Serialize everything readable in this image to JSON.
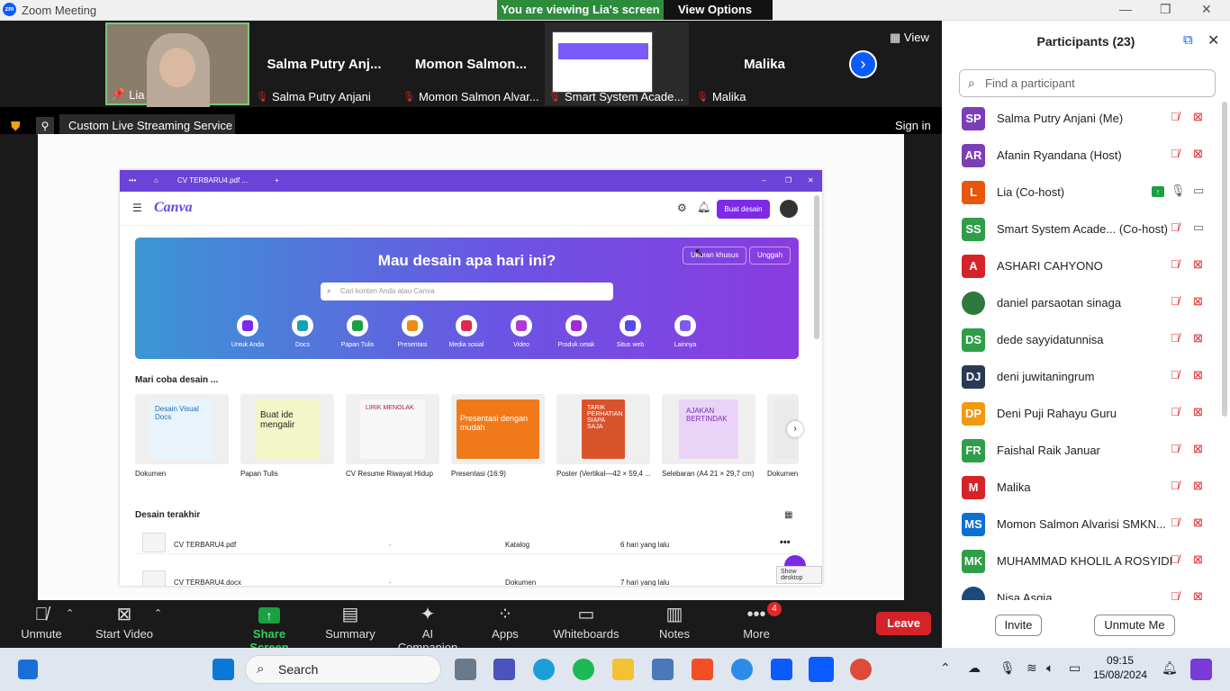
{
  "window": {
    "title": "Zoom Meeting",
    "app_logo": "zm"
  },
  "banner": {
    "message": "You are viewing Lia's screen",
    "options": "View Options"
  },
  "strip": {
    "view_label": "View",
    "tiles": [
      {
        "big": "",
        "label": "Lia"
      },
      {
        "big": "Salma Putry Anj...",
        "label": "Salma Putry Anjani"
      },
      {
        "big": "Momon Salmon...",
        "label": "Momon Salmon Alvar..."
      },
      {
        "big": "",
        "label": "Smart System Acade..."
      },
      {
        "big": "Malika",
        "label": "Malika"
      }
    ]
  },
  "livebar": {
    "service": "Custom Live Streaming Service",
    "signin": "Sign in"
  },
  "canva": {
    "tab": "CV TERBARU4.pdf ...",
    "logo": "Canva",
    "create_button": "Buat desain",
    "hero_title": "Mau desain apa hari ini?",
    "search_placeholder": "Cari konten Anda atau Canva",
    "custom_size": "Ukuran khusus",
    "upload": "Unggah",
    "categories": [
      "Untuk Anda",
      "Docs",
      "Papan Tulis",
      "Presentasi",
      "Media sosial",
      "Video",
      "Produk cetak",
      "Situs web",
      "Lainnya"
    ],
    "try_title": "Mari coba desain ...",
    "templates": [
      "Dokumen",
      "Papan Tulis",
      "CV Resume Riwayat Hidup",
      "Presentasi (16:9)",
      "Poster (Vertikal—42 × 59,4 ...",
      "Selebaran (A4 21 × 29,7 cm)",
      "Dokumen"
    ],
    "template_texts": [
      "Desain Visual Docs",
      "Buat ide mengalir",
      "LIRIK MENOLAK",
      "Presentasi dengan mudah",
      "TARIK PERHATIAN SIAPA SAJA",
      "AJAKAN BERTINDAK"
    ],
    "recent_title": "Desain terakhir",
    "recent": [
      {
        "name": "CV TERBARU4.pdf",
        "dash": "-",
        "type": "Katalog",
        "time": "6 hari yang lalu"
      },
      {
        "name": "CV TERBARU4.docx",
        "dash": "-",
        "type": "Dokumen",
        "time": "7 hari yang lalu"
      }
    ],
    "show_desktop": "Show desktop"
  },
  "participants": {
    "header": "Participants (23)",
    "search_placeholder": "Find a participant",
    "list": [
      {
        "initials": "SP",
        "name": "Salma Putry Anjani (Me)",
        "color": "#7b3fb5"
      },
      {
        "initials": "AR",
        "name": "Afanin Ryandana (Host)",
        "color": "#7b3fb5"
      },
      {
        "initials": "L",
        "name": "Lia (Co-host)",
        "color": "#e8550c"
      },
      {
        "initials": "SS",
        "name": "Smart System Acade...  (Co-host)",
        "color": "#2e9e48"
      },
      {
        "initials": "A",
        "name": "ASHARI CAHYONO",
        "color": "#d6232a"
      },
      {
        "initials": "",
        "name": "daniel  parsaotan sinaga",
        "color": "#2e7a3a"
      },
      {
        "initials": "DS",
        "name": "dede sayyidatunnisa",
        "color": "#2e9e48"
      },
      {
        "initials": "DJ",
        "name": "deni juwitaningrum",
        "color": "#2a3a55"
      },
      {
        "initials": "DP",
        "name": "Deni Puji Rahayu Guru",
        "color": "#f09a10"
      },
      {
        "initials": "FR",
        "name": "Faishal Raik Januar",
        "color": "#2e9e48"
      },
      {
        "initials": "M",
        "name": "Malika",
        "color": "#d6232a"
      },
      {
        "initials": "MS",
        "name": "Momon Salmon Alvarisi SMKN...",
        "color": "#0b6fd6"
      },
      {
        "initials": "MK",
        "name": "MUHAMMAD KHOLIL A ROSYIDI",
        "color": "#2e9e48"
      },
      {
        "initials": "",
        "name": "Nisa Asqia",
        "color": "#1a4a7a"
      }
    ],
    "invite": "Invite",
    "unmute_me": "Unmute Me"
  },
  "toolbar": {
    "unmute": "Unmute",
    "start_video": "Start Video",
    "share_screen": "Share Screen",
    "summary": "Summary",
    "ai_companion": "AI Companion",
    "apps": "Apps",
    "whiteboards": "Whiteboards",
    "notes": "Notes",
    "more": "More",
    "more_badge": "4",
    "leave": "Leave"
  },
  "taskbar": {
    "search": "Search",
    "time": "09:15",
    "date": "15/08/2024"
  }
}
